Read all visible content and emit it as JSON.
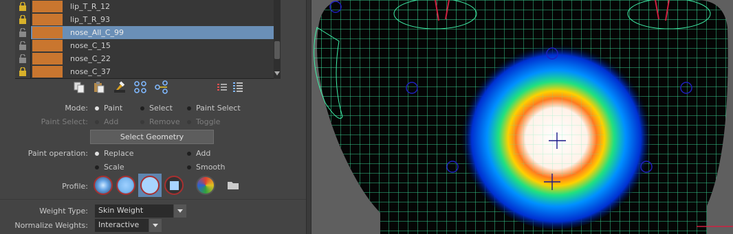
{
  "joints": [
    {
      "name": "lip_T_R_12",
      "locked": true,
      "selected": false
    },
    {
      "name": "lip_T_R_93",
      "locked": true,
      "selected": false
    },
    {
      "name": "nose_All_C_99",
      "locked": false,
      "selected": true
    },
    {
      "name": "nose_C_15",
      "locked": false,
      "selected": false
    },
    {
      "name": "nose_C_22",
      "locked": false,
      "selected": false
    },
    {
      "name": "nose_C_37",
      "locked": true,
      "selected": false
    }
  ],
  "toolbar_icons": [
    "copy-weights-icon",
    "paste-weights-icon",
    "weight-hammer-icon",
    "move-weights-icon",
    "transfer-joints-icon",
    "list-options-icon",
    "show-influences-icon"
  ],
  "mode": {
    "label": "Mode:",
    "paint": "Paint",
    "select": "Select",
    "paint_select": "Paint Select",
    "selected": "Paint"
  },
  "paint_select": {
    "label": "Paint Select:",
    "add": "Add",
    "remove": "Remove",
    "toggle": "Toggle"
  },
  "select_geometry": "Select Geometry",
  "paint_operation": {
    "label": "Paint operation:",
    "replace": "Replace",
    "add": "Add",
    "scale": "Scale",
    "smooth": "Smooth",
    "selected": "Replace"
  },
  "profile": {
    "label": "Profile:"
  },
  "weight_type": {
    "label": "Weight Type:",
    "value": "Skin Weight"
  },
  "normalize_weights": {
    "label": "Normalize Weights:",
    "value": "Interactive"
  },
  "colors": {
    "joint_swatch": "#c9762f",
    "selection": "#6a8fb7",
    "wireframe": "#3ff0a8"
  }
}
